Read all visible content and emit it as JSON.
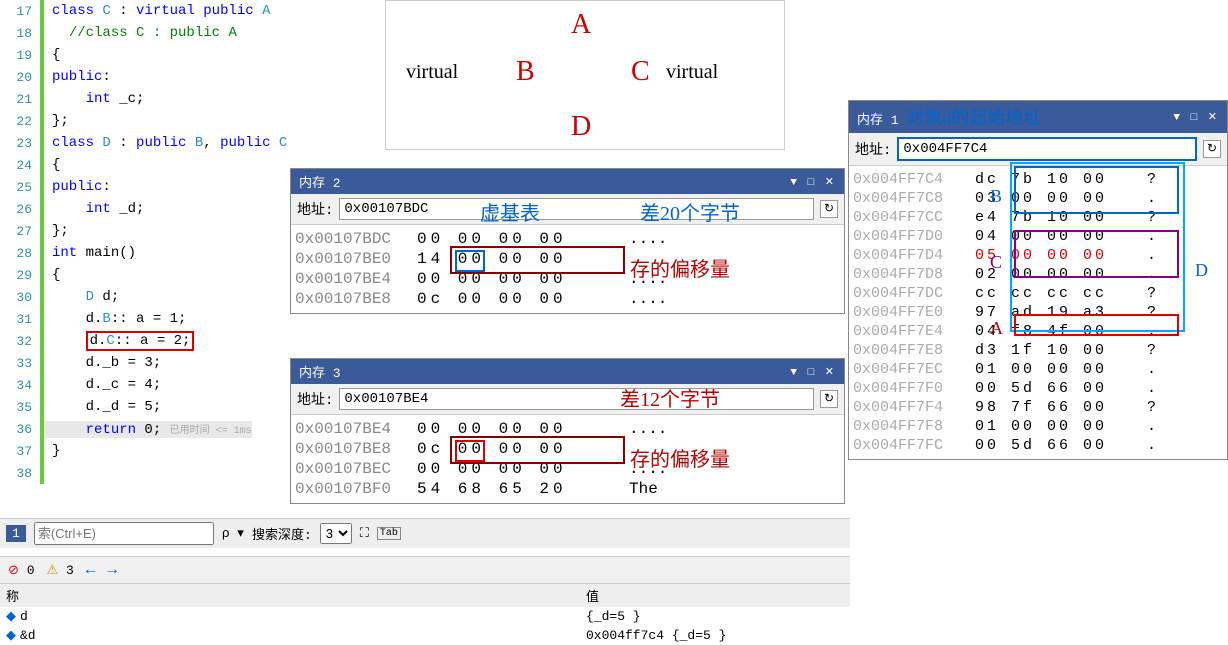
{
  "code": {
    "lines": [
      {
        "n": 17,
        "html": "<span class='kw'>class</span> <span class='type'>C</span> : <span class='kw'>virtual</span> <span class='kw'>public</span> <span class='type'>A</span>"
      },
      {
        "n": 18,
        "html": "  <span class='comment'>//class C : public A</span>"
      },
      {
        "n": 19,
        "html": "{"
      },
      {
        "n": 20,
        "html": "<span class='kw'>public</span>:"
      },
      {
        "n": 21,
        "html": "    <span class='kw'>int</span> _c;"
      },
      {
        "n": 22,
        "html": "};"
      },
      {
        "n": 23,
        "html": "<span class='kw'>class</span> <span class='type'>D</span> : <span class='kw'>public</span> <span class='type'>B</span>, <span class='kw'>public</span> <span class='type'>C</span>"
      },
      {
        "n": 24,
        "html": "{"
      },
      {
        "n": 25,
        "html": "<span class='kw'>public</span>:"
      },
      {
        "n": 26,
        "html": "    <span class='kw'>int</span> _d;"
      },
      {
        "n": 27,
        "html": "};"
      },
      {
        "n": 28,
        "html": "<span class='kw'>int</span> main()"
      },
      {
        "n": 29,
        "html": "{"
      },
      {
        "n": 30,
        "html": "    <span class='type'>D</span> d;"
      },
      {
        "n": 31,
        "html": "    d.<span class='type'>B</span>:: a = 1;"
      },
      {
        "n": 32,
        "html": "    <span class='box-red'>d.<span class='type'>C</span>:: a = 2;</span>"
      },
      {
        "n": 33,
        "html": "    d._b = 3;"
      },
      {
        "n": 34,
        "html": "    d._c = 4;"
      },
      {
        "n": 35,
        "html": "    d._d = 5;"
      },
      {
        "n": 36,
        "html": "    <span class='kw'>return</span> 0; <span style='color:#aaa;font-size:10px'>已用时间 &lt;= 1ms</span>"
      },
      {
        "n": 37,
        "html": "}"
      },
      {
        "n": 38,
        "html": ""
      }
    ]
  },
  "diagram": {
    "A": "A",
    "B": "B",
    "C": "C",
    "D": "D",
    "virtual": "virtual"
  },
  "mem2": {
    "title": "内存 2",
    "addr_label": "地址:",
    "addr": "0x00107BDC",
    "rows": [
      {
        "addr": "0x00107BDC",
        "hex": "00 00 00 00",
        "ascii": "...."
      },
      {
        "addr": "0x00107BE0",
        "hex": "14 00 00 00",
        "ascii": ""
      },
      {
        "addr": "0x00107BE4",
        "hex": "00 00 00 00",
        "ascii": "...."
      },
      {
        "addr": "0x00107BE8",
        "hex": "0c 00 00 00",
        "ascii": "...."
      }
    ]
  },
  "mem3": {
    "title": "内存 3",
    "addr_label": "地址:",
    "addr": "0x00107BE4",
    "rows": [
      {
        "addr": "0x00107BE4",
        "hex": "00 00 00 00",
        "ascii": "...."
      },
      {
        "addr": "0x00107BE8",
        "hex": "0c 00 00 00",
        "ascii": ""
      },
      {
        "addr": "0x00107BEC",
        "hex": "00 00 00 00",
        "ascii": "...."
      },
      {
        "addr": "0x00107BF0",
        "hex": "54 68 65 20",
        "ascii": "The"
      }
    ]
  },
  "mem1": {
    "title": "内存 1",
    "addr_label": "地址:",
    "addr": "0x004FF7C4",
    "rows": [
      {
        "addr": "0x004FF7C4",
        "hex": "dc 7b 10 00",
        "ascii": "?"
      },
      {
        "addr": "0x004FF7C8",
        "hex": "03 00 00 00",
        "ascii": "."
      },
      {
        "addr": "0x004FF7CC",
        "hex": "e4 7b 10 00",
        "ascii": "?"
      },
      {
        "addr": "0x004FF7D0",
        "hex": "04 00 00 00",
        "ascii": "."
      },
      {
        "addr": "0x004FF7D4",
        "hex": "05 00 00 00",
        "ascii": "."
      },
      {
        "addr": "0x004FF7D8",
        "hex": "02 00 00 00",
        "ascii": "."
      },
      {
        "addr": "0x004FF7DC",
        "hex": "cc cc cc cc",
        "ascii": "?"
      },
      {
        "addr": "0x004FF7E0",
        "hex": "97 ad 19 a3",
        "ascii": "?"
      },
      {
        "addr": "0x004FF7E4",
        "hex": "04 f8 4f 00",
        "ascii": "."
      },
      {
        "addr": "0x004FF7E8",
        "hex": "d3 1f 10 00",
        "ascii": "?"
      },
      {
        "addr": "0x004FF7EC",
        "hex": "01 00 00 00",
        "ascii": "."
      },
      {
        "addr": "0x004FF7F0",
        "hex": "00 5d 66 00",
        "ascii": "."
      },
      {
        "addr": "0x004FF7F4",
        "hex": "98 7f 66 00",
        "ascii": "?"
      },
      {
        "addr": "0x004FF7F8",
        "hex": "01 00 00 00",
        "ascii": "."
      },
      {
        "addr": "0x004FF7FC",
        "hex": "00 5d 66 00",
        "ascii": "."
      }
    ]
  },
  "annotations": {
    "obj_d": "对象d的起始地址",
    "vbtable": "虚基表",
    "diff20": "差20个字节",
    "diff12": "差12个字节",
    "offset": "存的偏移量",
    "B": "B",
    "C": "C",
    "D": "D",
    "A": "A"
  },
  "status": {
    "errors": "0",
    "warnings": "3"
  },
  "search": {
    "label_depth": "搜索深度:",
    "depth": "3",
    "placeholder": "索(Ctrl+E)",
    "tab1": "1"
  },
  "watch": {
    "col_name": "称",
    "col_value": "值",
    "rows": [
      {
        "name": "d",
        "value": "{_d=5 }"
      },
      {
        "name": "&d",
        "value": "0x004ff7c4 {_d=5 }"
      }
    ]
  }
}
